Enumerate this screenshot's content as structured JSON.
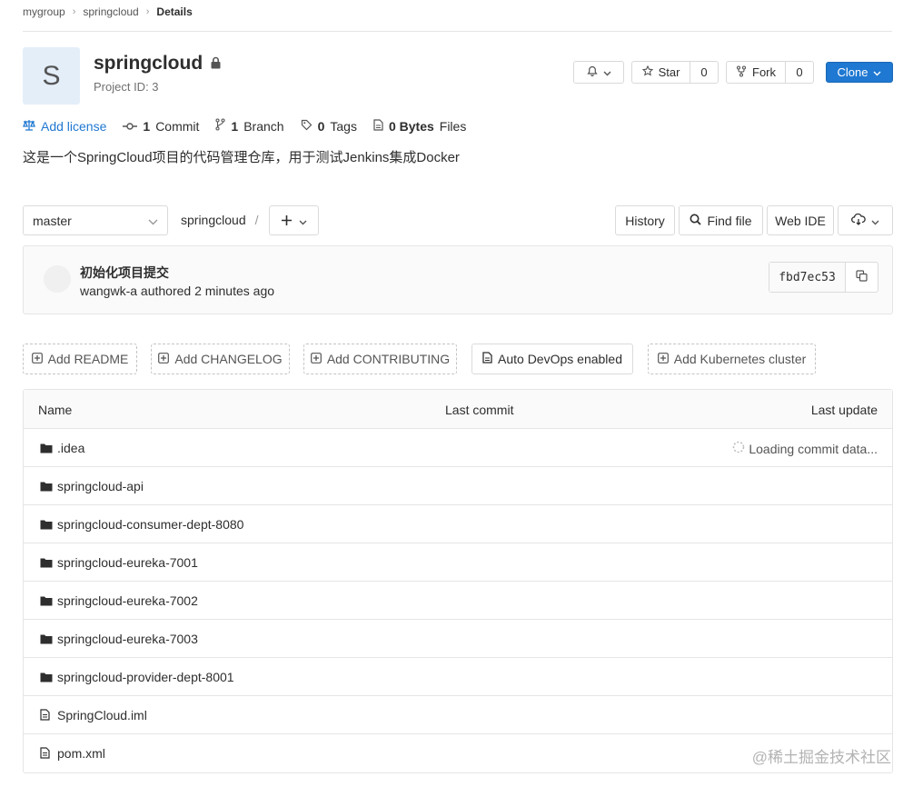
{
  "breadcrumb": {
    "group": "mygroup",
    "project": "springcloud",
    "current": "Details"
  },
  "project": {
    "avatar_letter": "S",
    "name": "springcloud",
    "id_label": "Project ID: 3"
  },
  "header_actions": {
    "star_label": "Star",
    "star_count": "0",
    "fork_label": "Fork",
    "fork_count": "0",
    "clone_label": "Clone"
  },
  "stats": {
    "license": "Add license",
    "commits_count": "1",
    "commits_label": "Commit",
    "branches_count": "1",
    "branches_label": "Branch",
    "tags_count": "0",
    "tags_label": "Tags",
    "size_value": "0 Bytes",
    "size_label": "Files"
  },
  "description": "这是一个SpringCloud项目的代码管理仓库，用于测试Jenkins集成Docker",
  "repo_nav": {
    "branch": "master",
    "path": "springcloud",
    "history": "History",
    "find_file": "Find file",
    "web_ide": "Web IDE"
  },
  "last_commit": {
    "title": "初始化项目提交",
    "author_line": "wangwk-a authored 2 minutes ago",
    "sha": "fbd7ec53"
  },
  "quick_actions": {
    "readme": "Add README",
    "changelog": "Add CHANGELOG",
    "contributing": "Add CONTRIBUTING",
    "devops": "Auto DevOps enabled",
    "kubernetes": "Add Kubernetes cluster"
  },
  "file_table": {
    "col_name": "Name",
    "col_last_commit": "Last commit",
    "col_last_update": "Last update",
    "loading_text": "Loading commit data...",
    "rows": [
      {
        "name": ".idea",
        "type": "folder"
      },
      {
        "name": "springcloud-api",
        "type": "folder"
      },
      {
        "name": "springcloud-consumer-dept-8080",
        "type": "folder"
      },
      {
        "name": "springcloud-eureka-7001",
        "type": "folder"
      },
      {
        "name": "springcloud-eureka-7002",
        "type": "folder"
      },
      {
        "name": "springcloud-eureka-7003",
        "type": "folder"
      },
      {
        "name": "springcloud-provider-dept-8001",
        "type": "folder"
      },
      {
        "name": "SpringCloud.iml",
        "type": "file"
      },
      {
        "name": "pom.xml",
        "type": "file"
      }
    ]
  },
  "watermark": "@稀土掘金技术社区"
}
